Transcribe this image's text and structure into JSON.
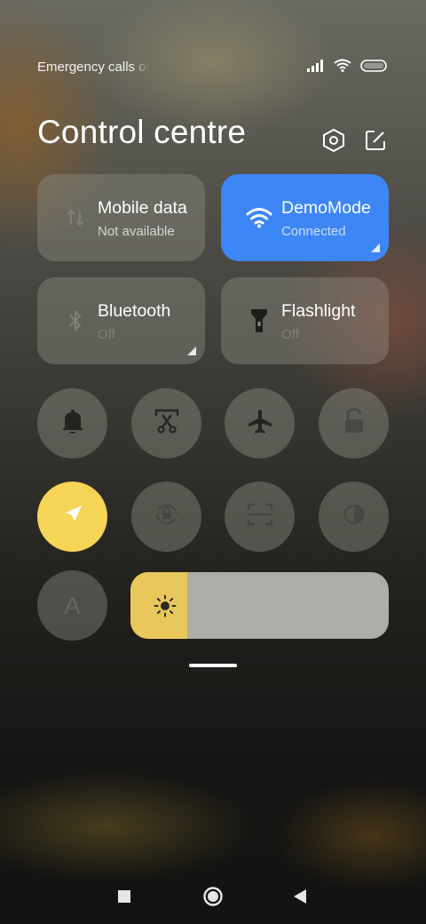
{
  "status_bar": {
    "text": "Emergency calls only",
    "icons": [
      "signal-icon",
      "wifi-icon",
      "battery-icon"
    ]
  },
  "header": {
    "title": "Control centre",
    "buttons": [
      "settings-icon",
      "edit-icon"
    ]
  },
  "tiles": [
    {
      "id": "mobile-data",
      "label": "Mobile data",
      "status": "Not available",
      "icon": "mobile-data-icon",
      "active": false
    },
    {
      "id": "wifi",
      "label": "DemoMode",
      "status": "Connected",
      "icon": "wifi-icon",
      "active": true
    },
    {
      "id": "bluetooth",
      "label": "Bluetooth",
      "status": "Off",
      "icon": "bluetooth-icon",
      "active": false
    },
    {
      "id": "flashlight",
      "label": "Flashlight",
      "status": "Off",
      "icon": "flashlight-icon",
      "active": false
    }
  ],
  "toggles": [
    {
      "id": "sound",
      "icon": "bell-icon",
      "on": false
    },
    {
      "id": "screenshot",
      "icon": "screenshot-icon",
      "on": false
    },
    {
      "id": "airplane-mode",
      "icon": "airplane-icon",
      "on": false
    },
    {
      "id": "lock-screen",
      "icon": "lock-icon",
      "on": false
    },
    {
      "id": "location",
      "icon": "location-arrow-icon",
      "on": true
    },
    {
      "id": "rotation-lock",
      "icon": "rotation-lock-icon",
      "on": false
    },
    {
      "id": "scanner",
      "icon": "scan-frame-icon",
      "on": false
    },
    {
      "id": "dark-mode",
      "icon": "dark-mode-icon",
      "on": false
    },
    {
      "id": "auto-brightness",
      "icon": "auto-letter-icon",
      "label": "A",
      "on": false
    }
  ],
  "brightness": {
    "level": 0.22,
    "icon": "sun-icon"
  },
  "colors": {
    "accent_blue": "#3d86f6",
    "accent_yellow": "#f5d456",
    "brightness_fill": "#e8c85a"
  },
  "nav_bar": [
    "recents-square-icon",
    "home-circle-icon",
    "back-triangle-icon"
  ]
}
